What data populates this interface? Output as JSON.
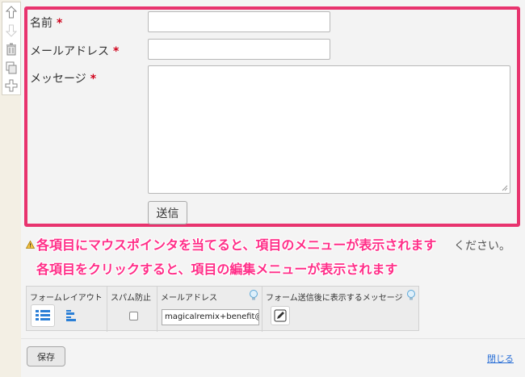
{
  "toolbar": {
    "icons": [
      "arrow-up-icon",
      "arrow-down-icon",
      "trash-icon",
      "duplicate-icon",
      "add-icon"
    ]
  },
  "form": {
    "fields": [
      {
        "label": "名前",
        "required_mark": "*"
      },
      {
        "label": "メールアドレス",
        "required_mark": "*"
      },
      {
        "label": "メッセージ",
        "required_mark": "*"
      }
    ],
    "submit_label": "送信",
    "highlight_color": "#e8336e"
  },
  "notice": {
    "text_tail": "ください。"
  },
  "overlay": {
    "line1": "各項目にマウスポインタを当てると、項目のメニューが表示されます",
    "line2": "各項目をクリックすると、項目の編集メニューが表示されます",
    "color": "#ff2e88"
  },
  "settings": {
    "form_layout_label": "フォームレイアウト",
    "spam_label": "スパム防止",
    "spam_checked": false,
    "email_label": "メールアドレス",
    "email_value": "magicalremix+benefit@",
    "message_label": "フォーム送信後に表示するメッセージ"
  },
  "footer": {
    "save_label": "保存",
    "close_label": "閉じる"
  }
}
